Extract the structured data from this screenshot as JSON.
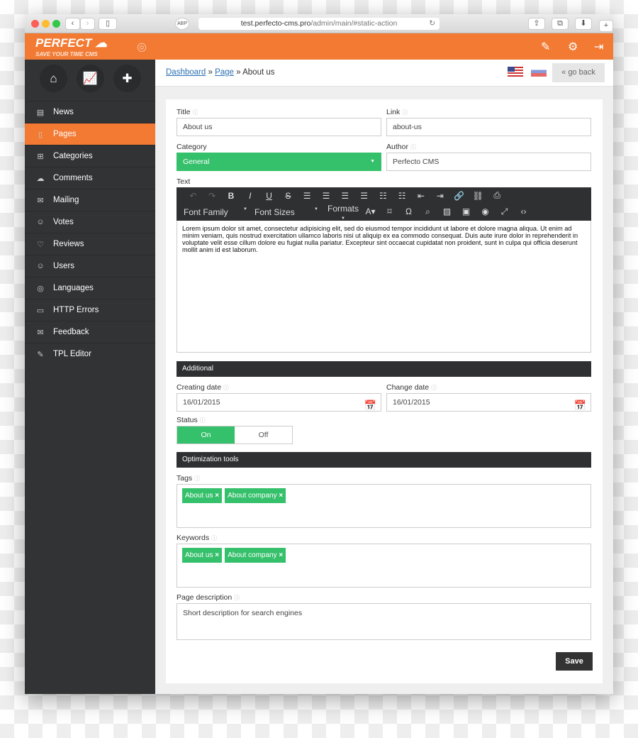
{
  "browser": {
    "url_host": "test.perfecto-cms.pro",
    "url_path": "/admin/main/#static-action"
  },
  "header": {
    "logo_main": "PERFECT",
    "logo_tag": "SAVE YOUR TIME",
    "logo_cms": "CMS"
  },
  "sidebar": {
    "items": [
      {
        "label": "News",
        "icon": "newspaper-icon"
      },
      {
        "label": "Pages",
        "icon": "page-icon",
        "active": true
      },
      {
        "label": "Categories",
        "icon": "tree-icon"
      },
      {
        "label": "Comments",
        "icon": "comment-icon"
      },
      {
        "label": "Mailing",
        "icon": "mail-icon"
      },
      {
        "label": "Votes",
        "icon": "vote-icon"
      },
      {
        "label": "Reviews",
        "icon": "heart-icon"
      },
      {
        "label": "Users",
        "icon": "user-icon"
      },
      {
        "label": "Languages",
        "icon": "globe-icon"
      },
      {
        "label": "HTTP Errors",
        "icon": "error-404-icon"
      },
      {
        "label": "Feedback",
        "icon": "envelope-icon"
      },
      {
        "label": "TPL Editor",
        "icon": "pencil-icon"
      }
    ]
  },
  "breadcrumb": {
    "dashboard": "Dashboard",
    "sep": "»",
    "page": "Page",
    "current": "About us"
  },
  "go_back": "« go back",
  "form": {
    "title_label": "Title",
    "title_value": "About us",
    "link_label": "Link",
    "link_value": "about-us",
    "category_label": "Category",
    "category_value": "General",
    "author_label": "Author",
    "author_value": "Perfecto CMS",
    "text_label": "Text",
    "font_family": "Font Family",
    "font_sizes": "Font Sizes",
    "formats": "Formats",
    "text_value": "Lorem ipsum dolor sit amet, consectetur adipisicing elit, sed do eiusmod tempor incididunt ut labore et dolore magna aliqua. Ut enim ad minim veniam, quis nostrud exercitation ullamco laboris nisi ut aliquip ex ea commodo consequat. Duis aute irure dolor in reprehenderit in voluptate velit esse cillum dolore eu fugiat nulla pariatur. Excepteur sint occaecat cupidatat non proident, sunt in culpa qui officia deserunt mollit anim id est laborum.",
    "additional": "Additional",
    "creating_label": "Creating date",
    "creating_value": "16/01/2015",
    "change_label": "Change date",
    "change_value": "16/01/2015",
    "status_label": "Status",
    "status_on": "On",
    "status_off": "Off",
    "status_selected": "On",
    "optimization": "Optimization tools",
    "tags_label": "Tags",
    "tags": [
      "About us",
      "About company"
    ],
    "keywords_label": "Keywords",
    "keywords": [
      "About us",
      "About company"
    ],
    "desc_label": "Page description",
    "desc_value": "Short description for search engines",
    "save": "Save"
  },
  "colors": {
    "accent": "#f27a33",
    "green": "#35c06b",
    "dark": "#323335"
  }
}
